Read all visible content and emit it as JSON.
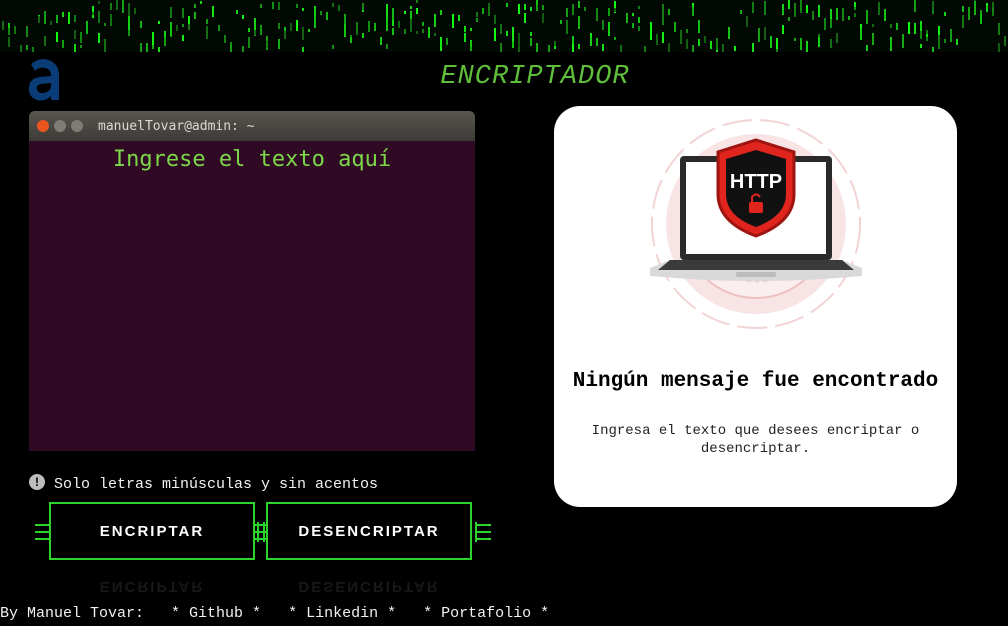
{
  "app": {
    "title": "ENCRIPTADOR"
  },
  "terminal": {
    "window_title": "manuelTovar@admin: ~",
    "placeholder": "Ingrese el texto aquí",
    "value": ""
  },
  "hint": {
    "icon": "exclamation-icon",
    "text": "Solo letras minúsculas y sin acentos"
  },
  "buttons": {
    "encrypt": "ENCRIPTAR",
    "decrypt": "DESENCRIPTAR"
  },
  "result": {
    "illustration_badge": "HTTP",
    "title": "Ningún mensaje fue encontrado",
    "subtitle": "Ingresa el texto que desees encriptar o desencriptar."
  },
  "footer": {
    "by": "By Manuel Tovar:",
    "links": [
      "* Github *",
      "* Linkedin *",
      "* Portafolio *"
    ]
  },
  "colors": {
    "accent_green": "#2bd42b",
    "terminal_bg": "#300a24",
    "title_green": "#5fbe3a",
    "logo_blue": "#0a3c78"
  }
}
